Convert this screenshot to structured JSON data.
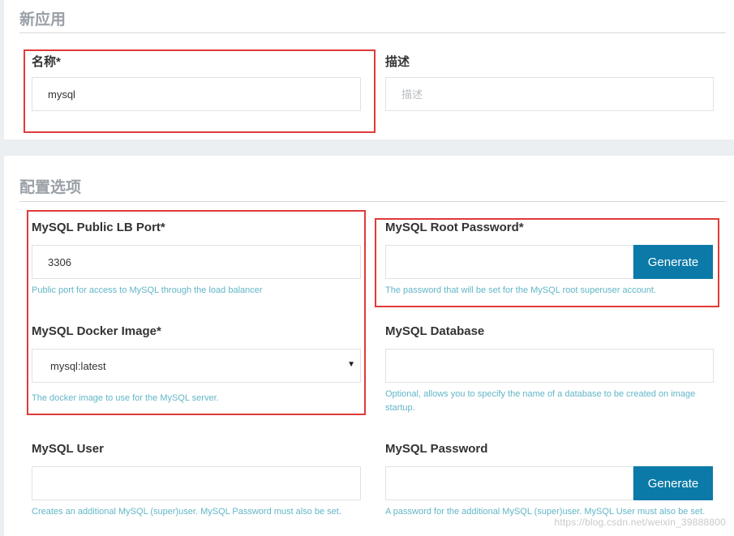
{
  "new_app": {
    "title": "新应用",
    "name_label": "名称*",
    "name_value": "mysql",
    "desc_label": "描述",
    "desc_placeholder": "描述"
  },
  "config": {
    "title": "配置选项",
    "public_port": {
      "label": "MySQL Public LB Port*",
      "value": "3306",
      "help": "Public port for access to MySQL through the load balancer"
    },
    "root_password": {
      "label": "MySQL Root Password*",
      "value": "",
      "button": "Generate",
      "help": "The password that will be set for the MySQL root superuser account."
    },
    "docker_image": {
      "label": "MySQL Docker Image*",
      "selected": "mysql:latest",
      "help": "The docker image to use for the MySQL server."
    },
    "database": {
      "label": "MySQL Database",
      "value": "",
      "help": "Optional, allows you to specify the name of a database to be created on image startup."
    },
    "user": {
      "label": "MySQL User",
      "value": "",
      "help": "Creates an additional MySQL (super)user. MySQL Password must also be set."
    },
    "password": {
      "label": "MySQL Password",
      "value": "",
      "button": "Generate",
      "help": "A password for the additional MySQL (super)user. MySQL User must also be set."
    }
  },
  "watermark": "https://blog.csdn.net/weixin_39888800",
  "colors": {
    "highlight_border": "#e03a3a",
    "button_bg": "#0b7aa8",
    "help_text": "#62b6c7"
  }
}
